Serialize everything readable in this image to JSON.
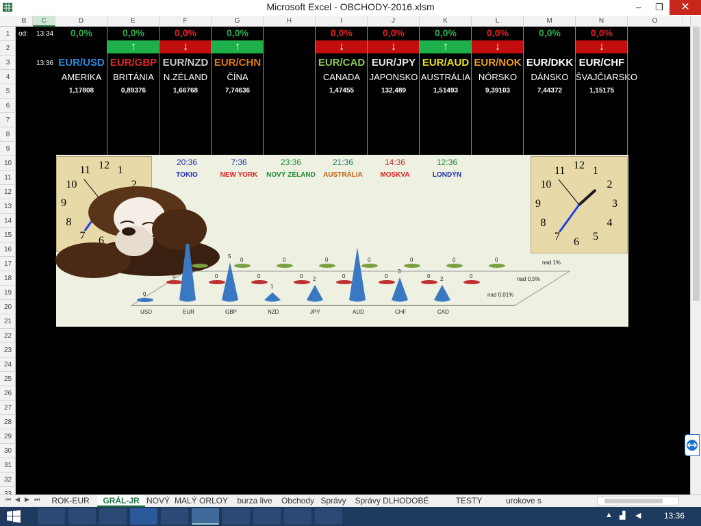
{
  "window": {
    "title": "Microsoft Excel - OBCHODY-2016.xlsm",
    "minimize": "–",
    "restore": "❐",
    "close": "✕"
  },
  "columns": [
    "B",
    "C",
    "D",
    "E",
    "F",
    "G",
    "H",
    "I",
    "J",
    "K",
    "L",
    "M",
    "N",
    "O"
  ],
  "selected_column": "C",
  "rows": [
    "1",
    "2",
    "3",
    "4",
    "5",
    "6",
    "7",
    "8",
    "9",
    "10",
    "11",
    "12",
    "13",
    "14",
    "15",
    "16",
    "17",
    "18",
    "19",
    "20",
    "21",
    "22",
    "23",
    "24",
    "25",
    "26",
    "27",
    "28",
    "29",
    "30",
    "31",
    "32",
    "33"
  ],
  "side_labels": {
    "od": "od:",
    "time1": "13:34",
    "time2": "13:36"
  },
  "pairs": [
    {
      "pct": "0,0%",
      "dir": "none",
      "pair": "EUR/USD",
      "pair_color": "#2b8be0",
      "country": "AMERIKA",
      "rate": "1,17808"
    },
    {
      "pct": "0,0%",
      "dir": "up",
      "pair": "EUR/GBP",
      "pair_color": "#e02828",
      "country": "BRITÁNIA",
      "rate": "0,89376"
    },
    {
      "pct": "0,0%",
      "dir": "down",
      "pair": "EUR/NZD",
      "pair_color": "#c9c9c9",
      "country": "N.ZÉLAND",
      "rate": "1,66768"
    },
    {
      "pct": "0,0%",
      "dir": "up",
      "pair": "EUR/CHN",
      "pair_color": "#e07a18",
      "country": "ČÍNA",
      "rate": "7,74636"
    },
    {
      "pct": "",
      "dir": "none",
      "pair": "",
      "pair_color": "#fff",
      "country": "",
      "rate": ""
    },
    {
      "pct": "0,0%",
      "dir": "down",
      "pair": "EUR/CAD",
      "pair_color": "#8ec85a",
      "country": "CANADA",
      "rate": "1,47455"
    },
    {
      "pct": "0,0%",
      "dir": "down",
      "pair": "EUR/JPY",
      "pair_color": "#e8e8e8",
      "country": "JAPONSKO",
      "rate": "132,489"
    },
    {
      "pct": "0,0%",
      "dir": "up",
      "pair": "EUR/AUD",
      "pair_color": "#e8e020",
      "country": "AUSTRÁLIA",
      "rate": "1,51493"
    },
    {
      "pct": "0,0%",
      "dir": "down",
      "pair": "EUR/NOK",
      "pair_color": "#f0a020",
      "country": "NÓRSKO",
      "rate": "9,39103"
    },
    {
      "pct": "0,0%",
      "dir": "none",
      "pair": "EUR/DKK",
      "pair_color": "#ffffff",
      "country": "DÁNSKO",
      "rate": "7,44372"
    },
    {
      "pct": "0,0%",
      "dir": "down",
      "pair": "EUR/CHF",
      "pair_color": "#ffffff",
      "country": "ŠVAJČIARSKO",
      "rate": "1,15175"
    }
  ],
  "arrows": {
    "up": "↑",
    "down": "↓"
  },
  "cities": [
    {
      "time": "20:36",
      "name": "TOKIO",
      "time_color": "#2030b0",
      "name_color": "#2030b0"
    },
    {
      "time": "7:36",
      "name": "NEW YORK",
      "time_color": "#2030b0",
      "name_color": "#e02020"
    },
    {
      "time": "23:36",
      "name": "NOVÝ ZÉLAND",
      "time_color": "#1a8a30",
      "name_color": "#1a8a30"
    },
    {
      "time": "21:36",
      "name": "AUSTRÁLIA",
      "time_color": "#1a7a6a",
      "name_color": "#c06010"
    },
    {
      "time": "14:36",
      "name": "MOSKVA",
      "time_color": "#c03030",
      "name_color": "#e02020"
    },
    {
      "time": "12:36",
      "name": "LONDÝN",
      "time_color": "#1a8a30",
      "name_color": "#2030b0"
    }
  ],
  "clock_numbers": [
    "12",
    "1",
    "2",
    "3",
    "4",
    "5",
    "6",
    "7",
    "8",
    "9",
    "10",
    "11"
  ],
  "chart_data": {
    "type": "bar",
    "categories": [
      "USD",
      "EUR",
      "GBP",
      "NZD",
      "JPY",
      "AUD",
      "CHF",
      "CAD"
    ],
    "series": [
      {
        "name": "nad 0,01%",
        "values": [
          0,
          9,
          5,
          1,
          2,
          7,
          3,
          2
        ],
        "color": "#3a78c4"
      },
      {
        "name": "nad 0,5%",
        "values": [
          0,
          0,
          0,
          0,
          0,
          0,
          0,
          0
        ],
        "color": "#c03030"
      },
      {
        "name": "nad 1%",
        "values": [
          0,
          0,
          0,
          0,
          0,
          0,
          0,
          0
        ],
        "color": "#7aa040"
      }
    ]
  },
  "sheet_tabs": [
    "ROK-EUR",
    "GRÁL-JR",
    "NOVÝ",
    "MALÝ ORLOY",
    "burza live",
    "Obchody",
    "Správy",
    "Správy DLHODOBÉ",
    "TESTY ROBOTOV",
    "urokove s"
  ],
  "active_tab": "GRÁL-JR",
  "taskbar": {
    "clock": "13:36"
  }
}
